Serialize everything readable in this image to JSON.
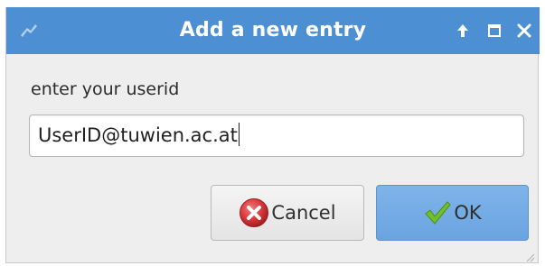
{
  "window": {
    "title": "Add a new entry",
    "icons": {
      "app": "app-icon",
      "up": "arrow-up-icon",
      "maximize": "maximize-icon",
      "close": "close-icon"
    }
  },
  "form": {
    "prompt": "enter your userid",
    "userid_value": "UserID@tuwien.ac.at"
  },
  "buttons": {
    "cancel_label": "Cancel",
    "ok_label": "OK",
    "cancel_icon": "red-x-icon",
    "ok_icon": "green-check-icon"
  },
  "colors": {
    "titlebar": "#4d8fd3",
    "ok_button": "#6aa4e0",
    "cancel_icon": "#d9373a",
    "ok_icon": "#71c02b"
  }
}
